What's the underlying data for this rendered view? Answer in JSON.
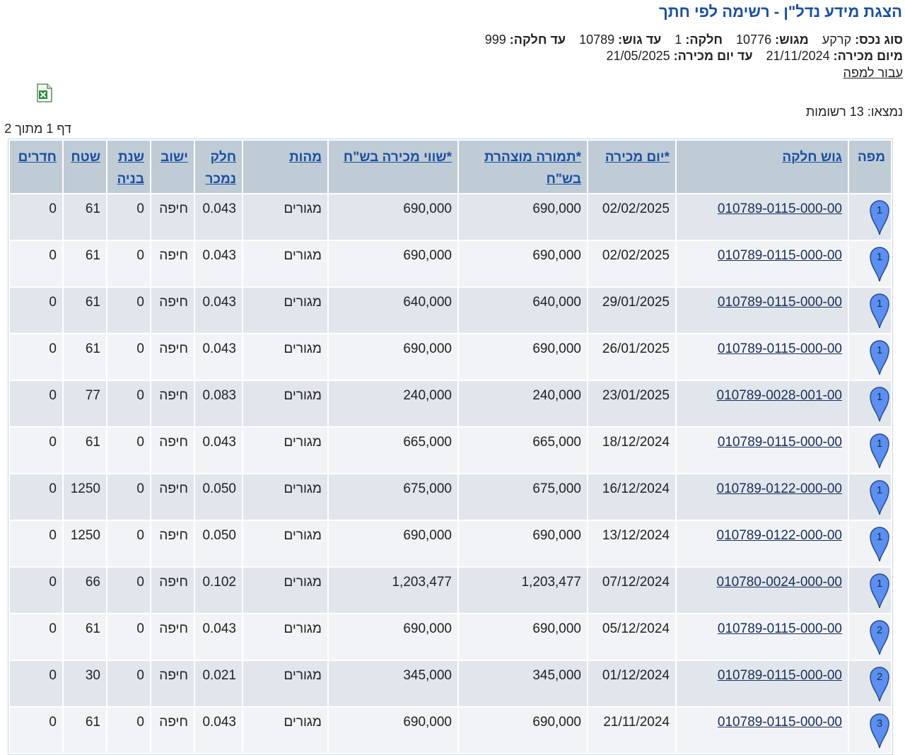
{
  "page": {
    "title": "הצגת מידע נדל\"ן - רשימה לפי חתך",
    "map_link": "עבור למפה",
    "found_text": "נמצאו: 13 רשומות",
    "pager_text": "דף 1 מתוך 2"
  },
  "criteria": {
    "asset_type_label": "סוג נכס:",
    "asset_type_value": "קרקע",
    "from_block_label": "מגוש:",
    "from_block_value": "10776",
    "parcel_label": "חלקה:",
    "parcel_value": "1",
    "to_block_label": "עד גוש:",
    "to_block_value": "10789",
    "to_parcel_label": "עד חלקה:",
    "to_parcel_value": "999",
    "from_date_label": "מיום מכירה:",
    "from_date_value": "21/11/2024",
    "to_date_label": "עד יום מכירה:",
    "to_date_value": "21/05/2025"
  },
  "table": {
    "headers": {
      "map": "מפה",
      "block_parcel": "גוש חלקה",
      "sale_date": "*יום מכירה",
      "declared_price": "*תמורה מוצהרת בש\"ח",
      "sale_value": "*שווי מכירה בש\"ח",
      "nature": "מהות",
      "share_sold": "חלק נמכר",
      "locality": "ישוב",
      "build_year": "שנת בניה",
      "area": "שטח",
      "rooms": "חדרים"
    },
    "rows": [
      {
        "pin": "1",
        "block_parcel": "010789-0115-000-00",
        "sale_date": "02/02/2025",
        "declared_price": "690,000",
        "sale_value": "690,000",
        "nature": "מגורים",
        "share_sold": "0.043",
        "locality": "חיפה",
        "build_year": "0",
        "area": "61",
        "rooms": "0"
      },
      {
        "pin": "1",
        "block_parcel": "010789-0115-000-00",
        "sale_date": "02/02/2025",
        "declared_price": "690,000",
        "sale_value": "690,000",
        "nature": "מגורים",
        "share_sold": "0.043",
        "locality": "חיפה",
        "build_year": "0",
        "area": "61",
        "rooms": "0"
      },
      {
        "pin": "1",
        "block_parcel": "010789-0115-000-00",
        "sale_date": "29/01/2025",
        "declared_price": "640,000",
        "sale_value": "640,000",
        "nature": "מגורים",
        "share_sold": "0.043",
        "locality": "חיפה",
        "build_year": "0",
        "area": "61",
        "rooms": "0"
      },
      {
        "pin": "1",
        "block_parcel": "010789-0115-000-00",
        "sale_date": "26/01/2025",
        "declared_price": "690,000",
        "sale_value": "690,000",
        "nature": "מגורים",
        "share_sold": "0.043",
        "locality": "חיפה",
        "build_year": "0",
        "area": "61",
        "rooms": "0"
      },
      {
        "pin": "1",
        "block_parcel": "010789-0028-001-00",
        "sale_date": "23/01/2025",
        "declared_price": "240,000",
        "sale_value": "240,000",
        "nature": "מגורים",
        "share_sold": "0.083",
        "locality": "חיפה",
        "build_year": "0",
        "area": "77",
        "rooms": "0"
      },
      {
        "pin": "1",
        "block_parcel": "010789-0115-000-00",
        "sale_date": "18/12/2024",
        "declared_price": "665,000",
        "sale_value": "665,000",
        "nature": "מגורים",
        "share_sold": "0.043",
        "locality": "חיפה",
        "build_year": "0",
        "area": "61",
        "rooms": "0"
      },
      {
        "pin": "1",
        "block_parcel": "010789-0122-000-00",
        "sale_date": "16/12/2024",
        "declared_price": "675,000",
        "sale_value": "675,000",
        "nature": "מגורים",
        "share_sold": "0.050",
        "locality": "חיפה",
        "build_year": "0",
        "area": "1250",
        "rooms": "0"
      },
      {
        "pin": "1",
        "block_parcel": "010789-0122-000-00",
        "sale_date": "13/12/2024",
        "declared_price": "690,000",
        "sale_value": "690,000",
        "nature": "מגורים",
        "share_sold": "0.050",
        "locality": "חיפה",
        "build_year": "0",
        "area": "1250",
        "rooms": "0"
      },
      {
        "pin": "1",
        "block_parcel": "010780-0024-000-00",
        "sale_date": "07/12/2024",
        "declared_price": "1,203,477",
        "sale_value": "1,203,477",
        "nature": "מגורים",
        "share_sold": "0.102",
        "locality": "חיפה",
        "build_year": "0",
        "area": "66",
        "rooms": "0"
      },
      {
        "pin": "2",
        "block_parcel": "010789-0115-000-00",
        "sale_date": "05/12/2024",
        "declared_price": "690,000",
        "sale_value": "690,000",
        "nature": "מגורים",
        "share_sold": "0.043",
        "locality": "חיפה",
        "build_year": "0",
        "area": "61",
        "rooms": "0"
      },
      {
        "pin": "2",
        "block_parcel": "010789-0115-000-00",
        "sale_date": "01/12/2024",
        "declared_price": "345,000",
        "sale_value": "345,000",
        "nature": "מגורים",
        "share_sold": "0.021",
        "locality": "חיפה",
        "build_year": "0",
        "area": "30",
        "rooms": "0"
      },
      {
        "pin": "3",
        "block_parcel": "010789-0115-000-00",
        "sale_date": "21/11/2024",
        "declared_price": "690,000",
        "sale_value": "690,000",
        "nature": "מגורים",
        "share_sold": "0.043",
        "locality": "חיפה",
        "build_year": "0",
        "area": "61",
        "rooms": "0"
      }
    ]
  },
  "colors": {
    "title": "#1a4fa0",
    "header_bg": "#bfccd6",
    "row_odd": "#e1e6ec",
    "row_even": "#f1f3f6",
    "pin_fill": "#5b8ff0",
    "pin_stroke": "#2a4a8a"
  },
  "icons": {
    "excel": "excel-file-icon",
    "pin": "map-pin-icon"
  }
}
